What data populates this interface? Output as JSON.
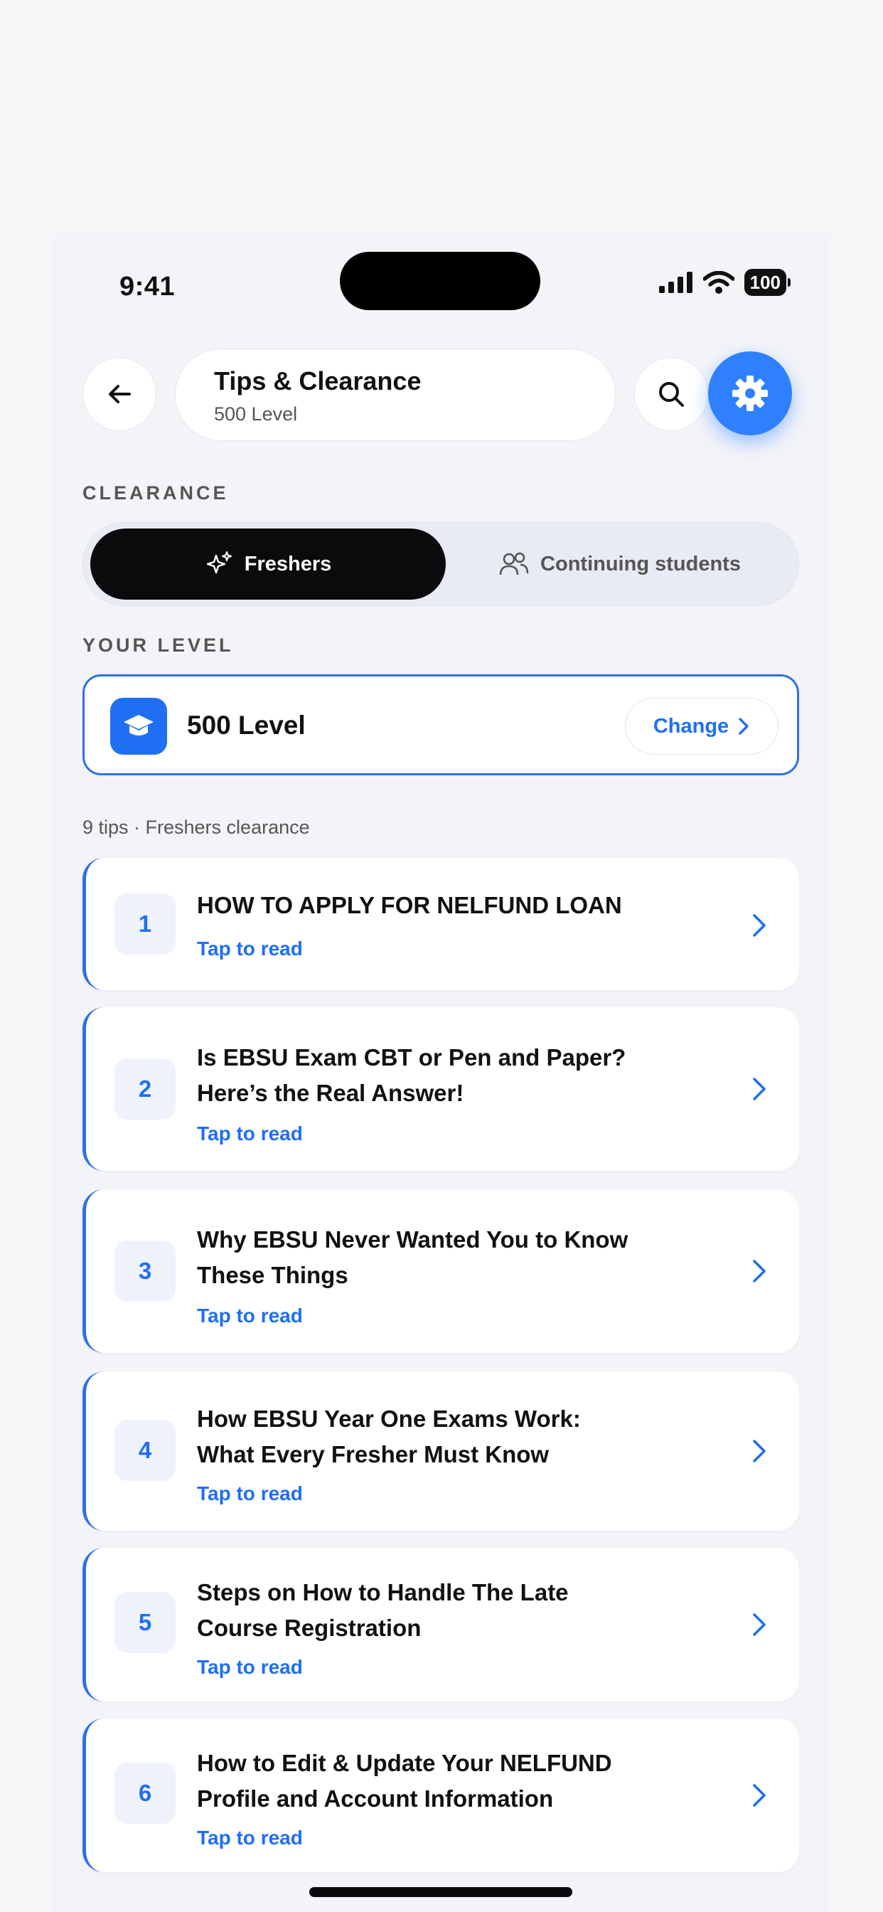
{
  "status": {
    "time": "9:41",
    "battery": "100"
  },
  "header": {
    "title": "Tips & Clearance",
    "subtitle": "500 Level"
  },
  "clearance": {
    "section_label": "CLEARANCE",
    "tabs": [
      {
        "label": "Freshers",
        "icon": "sparkles-icon",
        "active": true
      },
      {
        "label": "Continuing students",
        "icon": "users-icon",
        "active": false
      }
    ]
  },
  "level": {
    "section_label": "YOUR LEVEL",
    "name": "500 Level",
    "icon": "graduation-cap-icon",
    "change_label": "Change"
  },
  "tips_summary": "9 tips · Freshers clearance",
  "tips": [
    {
      "number": "1",
      "title_lines": [
        "HOW TO APPLY FOR NELFUND LOAN"
      ],
      "action": "Tap to read"
    },
    {
      "number": "2",
      "title_lines": [
        "Is EBSU Exam CBT or Pen and Paper?",
        "Here’s the Real Answer!"
      ],
      "action": "Tap to read"
    },
    {
      "number": "3",
      "title_lines": [
        "Why EBSU Never Wanted You to Know",
        "These Things"
      ],
      "action": "Tap to read"
    },
    {
      "number": "4",
      "title_lines": [
        "How EBSU Year One Exams Work:",
        "What Every Fresher Must Know"
      ],
      "action": "Tap to read"
    },
    {
      "number": "5",
      "title_lines": [
        "Steps on How to Handle The Late",
        "Course Registration"
      ],
      "action": "Tap to read"
    },
    {
      "number": "6",
      "title_lines": [
        "How to Edit & Update Your NELFUND",
        "Profile and Account Information"
      ],
      "action": "Tap to read"
    }
  ],
  "colors": {
    "accent": "#1f6ff3",
    "settings": "#2f80ff",
    "active_tab": "#0b0b0d"
  }
}
